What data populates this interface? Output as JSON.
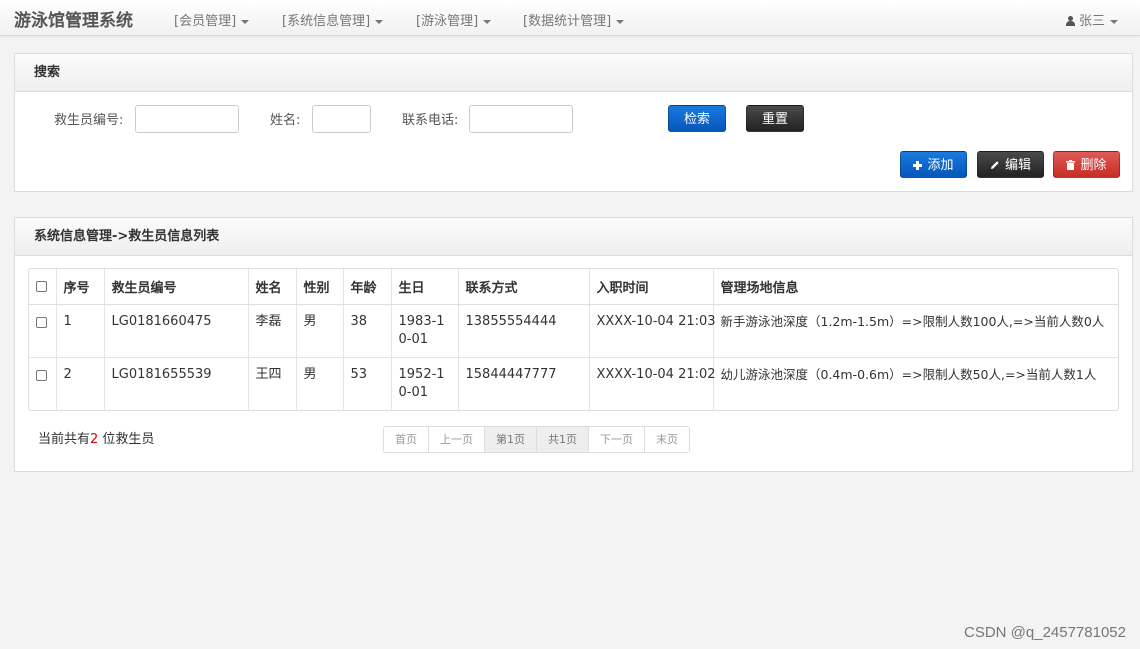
{
  "navbar": {
    "brand": "游泳馆管理系统",
    "menus": [
      {
        "label": "[会员管理]"
      },
      {
        "label": "[系统信息管理]"
      },
      {
        "label": "[游泳管理]"
      },
      {
        "label": "[数据统计管理]"
      }
    ],
    "user": "张三"
  },
  "search": {
    "title": "搜索",
    "fields": [
      {
        "label": "救生员编号:",
        "value": "",
        "placeholder": ""
      },
      {
        "label": "姓名:",
        "value": "",
        "placeholder": ""
      },
      {
        "label": "联系电话:",
        "value": "",
        "placeholder": ""
      }
    ],
    "search_button": "检索",
    "reset_button": "重置",
    "add_button": "添加",
    "edit_button": "编辑",
    "delete_button": "删除"
  },
  "list": {
    "title": "系统信息管理->救生员信息列表",
    "columns": [
      "序号",
      "救生员编号",
      "姓名",
      "性别",
      "年龄",
      "生日",
      "联系方式",
      "入职时间",
      "管理场地信息"
    ],
    "rows": [
      {
        "index": "1",
        "code": "LG0181660475",
        "name": "李磊",
        "gender": "男",
        "age": "38",
        "birthday": "1983-10-01",
        "phone": "13855554444",
        "hire_time": "XXXX-10-04 21:03",
        "venue": "新手游泳池深度（1.2m-1.5m）=>限制人数100人,=>当前人数0人"
      },
      {
        "index": "2",
        "code": "LG0181655539",
        "name": "王四",
        "gender": "男",
        "age": "53",
        "birthday": "1952-10-01",
        "phone": "15844447777",
        "hire_time": "XXXX-10-04 21:02",
        "venue": "幼儿游泳池深度（0.4m-0.6m）=>限制人数50人,=>当前人数1人"
      }
    ],
    "summary_prefix": "当前共有",
    "summary_count": "2",
    "summary_suffix": " 位救生员",
    "pager": [
      "首页",
      "上一页",
      "第1页",
      "共1页",
      "下一页",
      "末页"
    ]
  },
  "watermark": "CSDN @q_2457781052",
  "colors": {
    "primary": "#0d67cc",
    "dark": "#333333",
    "danger": "#d9423b",
    "count_red": "#d9000b"
  }
}
